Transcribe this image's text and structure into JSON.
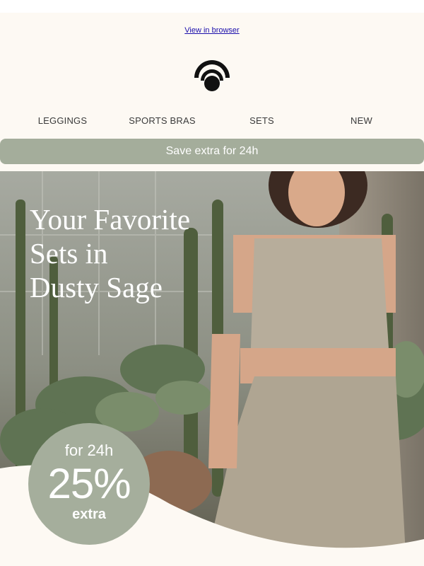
{
  "header": {
    "view_in_browser": "View in browser",
    "logo_icon": "brand-logo-icon"
  },
  "nav": {
    "items": [
      {
        "label": "LEGGINGS"
      },
      {
        "label": "SPORTS BRAS"
      },
      {
        "label": "SETS"
      },
      {
        "label": "NEW"
      }
    ]
  },
  "promo_bar": {
    "text": "Save extra for 24h"
  },
  "hero": {
    "title_lines": [
      "Your Favorite",
      "Sets in",
      "Dusty Sage"
    ],
    "badge": {
      "top": "for 24h",
      "main": "25%",
      "sub": "extra"
    }
  },
  "colors": {
    "page_bg": "#fdf9f3",
    "sage_accent": "#a4ad9b",
    "badge": "#a5ae9c",
    "link": "#1a0dab"
  }
}
